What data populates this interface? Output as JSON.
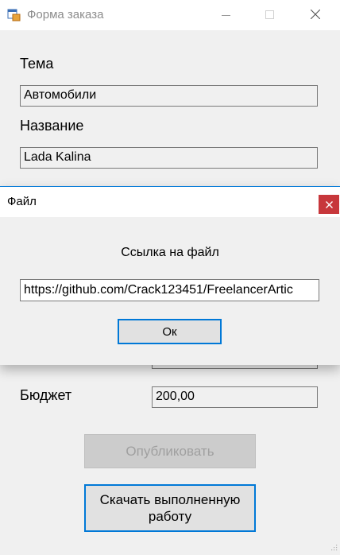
{
  "window": {
    "title": "Форма заказа"
  },
  "form": {
    "topic_label": "Тема",
    "topic_value": "Автомобили",
    "name_label": "Название",
    "name_value": "Lada Kalina",
    "budget_label": "Бюджет",
    "budget_value": "200,00",
    "publish_label": "Опубликовать",
    "download_label_line1": "Скачать выполненную",
    "download_label_line2": "работу"
  },
  "dialog": {
    "title": "Файл",
    "caption": "Ссылка на файл",
    "link_value": "https://github.com/Crack123451/FreelancerArtic",
    "ok_label": "Ок"
  },
  "colors": {
    "accent": "#0078d7",
    "close_red": "#c7373b"
  }
}
